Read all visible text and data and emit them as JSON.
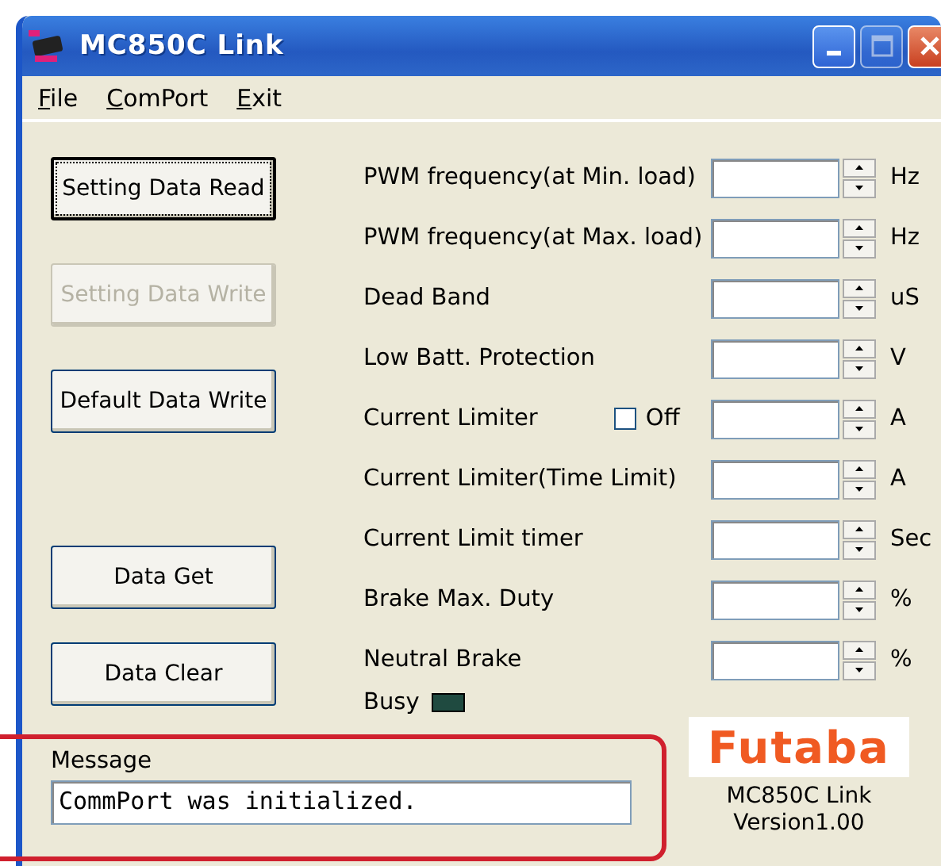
{
  "window": {
    "title": "MC850C Link"
  },
  "menu": [
    {
      "label": "File"
    },
    {
      "label": "ComPort"
    },
    {
      "label": "Exit"
    }
  ],
  "data_buttons": [
    {
      "label": "Setting Data Read",
      "disabled": false,
      "focused": true
    },
    {
      "label": "Setting Data Write",
      "disabled": true,
      "focused": false
    },
    {
      "label": "Default Data Write",
      "disabled": false,
      "focused": false
    }
  ],
  "transfer_buttons": [
    {
      "label": "Data Get",
      "disabled": false,
      "focused": false
    },
    {
      "label": "Data Clear",
      "disabled": false,
      "focused": false
    }
  ],
  "settings": [
    {
      "label": "PWM frequency(at Min. load)",
      "unit": "Hz"
    },
    {
      "label": "PWM frequency(at Max. load)",
      "unit": "Hz"
    },
    {
      "label": "Dead Band",
      "unit": "uS"
    },
    {
      "label": "Low Batt. Protection",
      "unit": "V"
    },
    {
      "label": "Current Limiter",
      "unit": "A",
      "checkbox": {
        "label": "Off",
        "checked": false
      }
    },
    {
      "label": "Current Limiter(Time Limit)",
      "unit": "A"
    },
    {
      "label": "Current Limit timer",
      "unit": "Sec"
    },
    {
      "label": "Brake Max. Duty",
      "unit": "%"
    },
    {
      "label": "Neutral Brake",
      "unit": "%"
    }
  ],
  "busy": {
    "label": "Busy",
    "on": false
  },
  "message": {
    "label": "Message",
    "value": "CommPort was initialized."
  },
  "logo": {
    "text": "Futaba"
  },
  "version": [
    "MC850C Link",
    "Version1.00"
  ],
  "highlight": {
    "shown": true
  }
}
